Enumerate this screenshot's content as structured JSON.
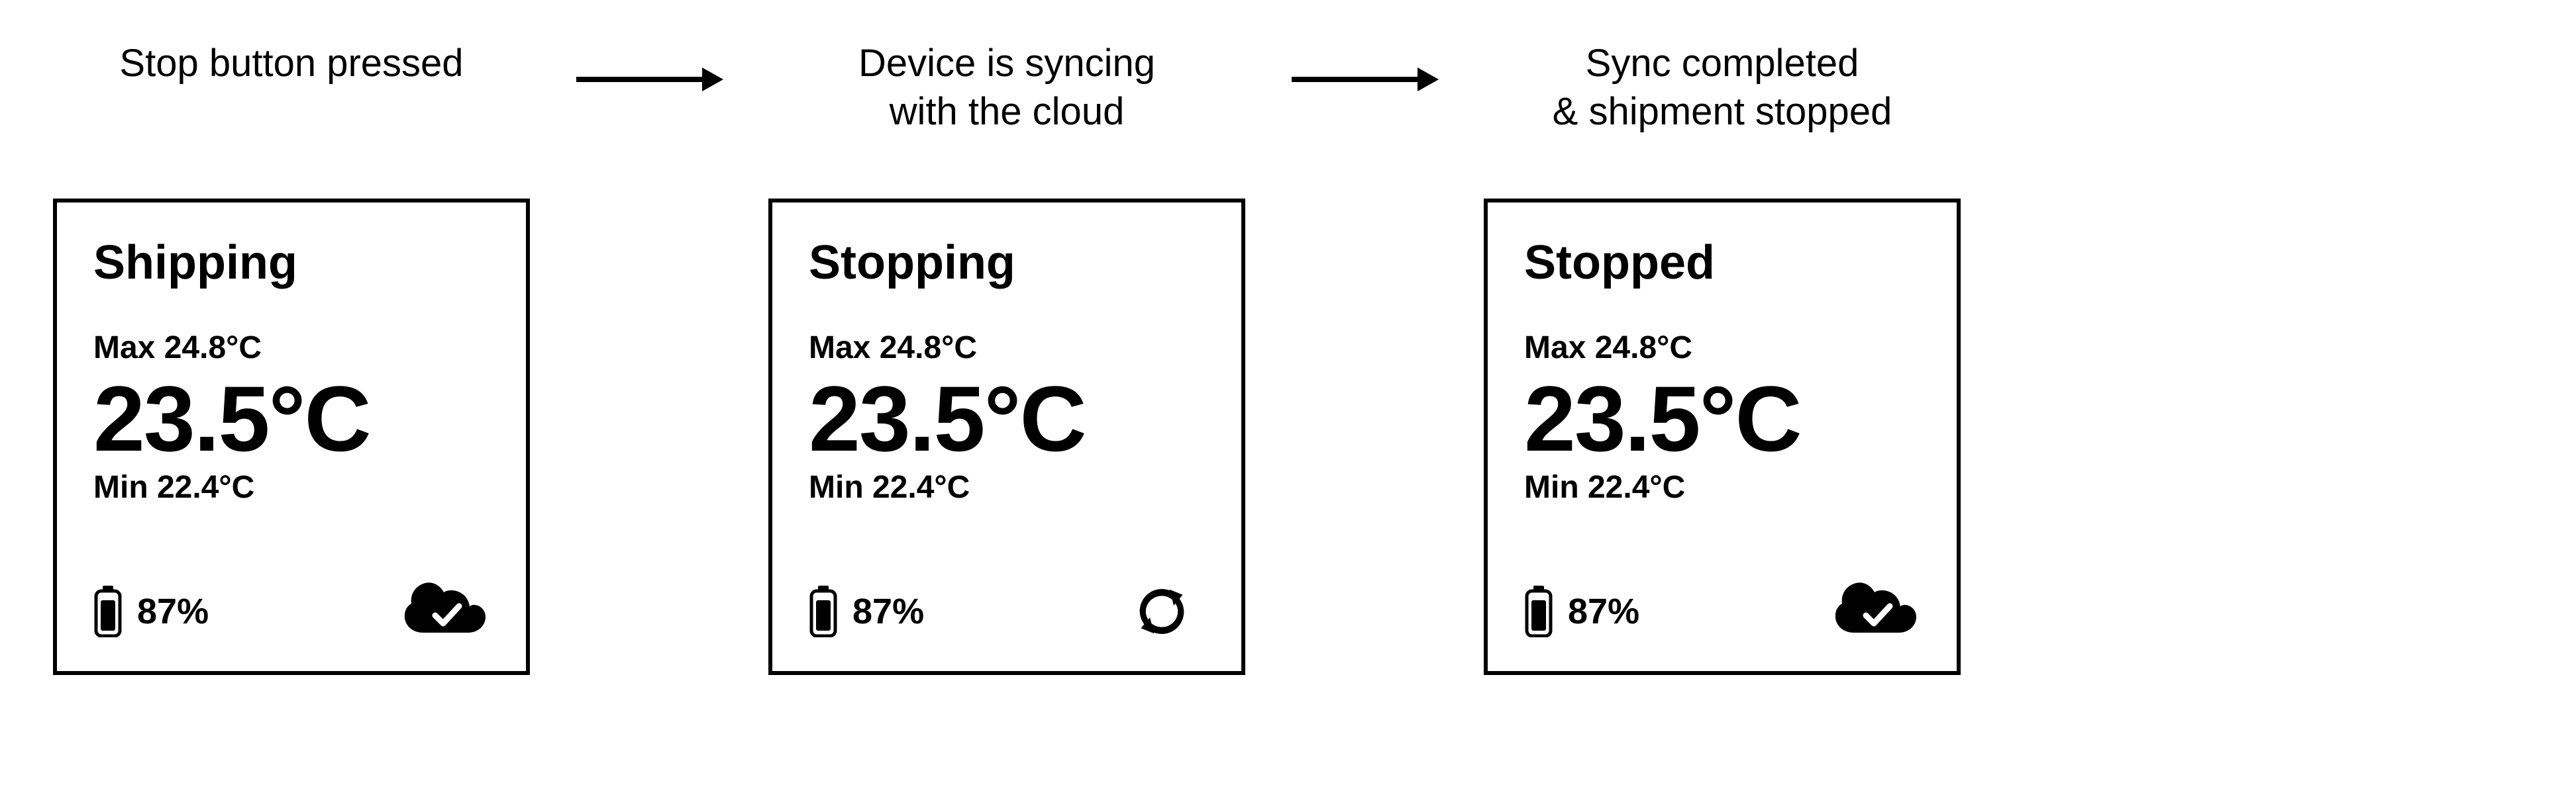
{
  "arrow_icon": "arrow-right",
  "stages": [
    {
      "caption_line1": "Stop button pressed",
      "caption_line2": "",
      "panel": {
        "title": "Shipping",
        "max_label": "Max 24.8°C",
        "temp": "23.5°C",
        "min_label": "Min 22.4°C",
        "battery": "87%",
        "status_icon": "cloud-check"
      }
    },
    {
      "caption_line1": "Device is syncing",
      "caption_line2": "with the cloud",
      "panel": {
        "title": "Stopping",
        "max_label": "Max 24.8°C",
        "temp": "23.5°C",
        "min_label": "Min 22.4°C",
        "battery": "87%",
        "status_icon": "sync"
      }
    },
    {
      "caption_line1": "Sync completed",
      "caption_line2": "& shipment stopped",
      "panel": {
        "title": "Stopped",
        "max_label": "Max 24.8°C",
        "temp": "23.5°C",
        "min_label": "Min 22.4°C",
        "battery": "87%",
        "status_icon": "cloud-check"
      }
    }
  ]
}
